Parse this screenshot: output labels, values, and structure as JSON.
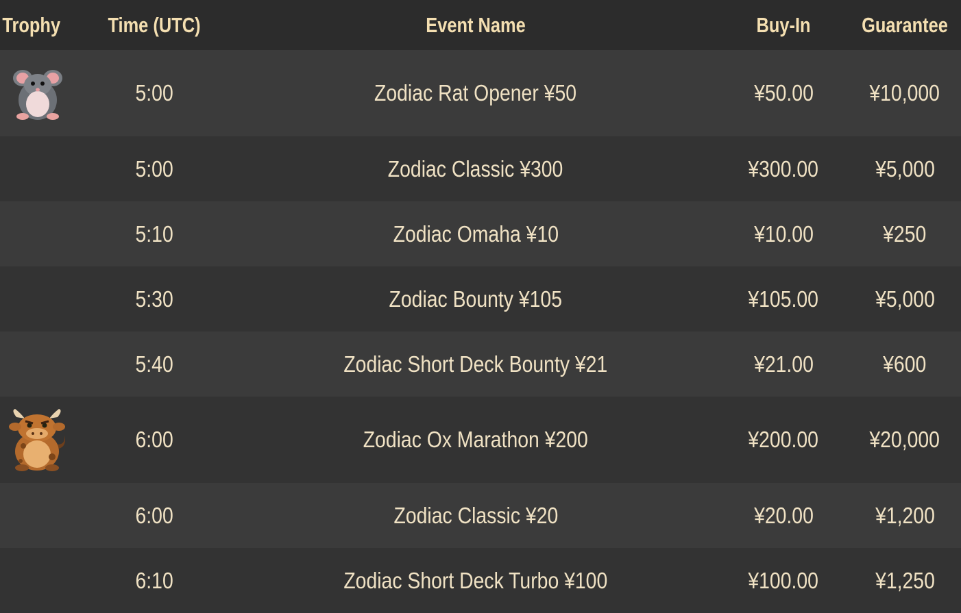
{
  "header": {
    "trophy": "Trophy",
    "time": "Time (UTC)",
    "event": "Event Name",
    "buyin": "Buy-In",
    "guarantee": "Guarantee"
  },
  "rows": [
    {
      "trophy_icon": "rat-trophy-icon",
      "time": "5:00",
      "event": "Zodiac Rat Opener ¥50",
      "buyin": "¥50.00",
      "guarantee": "¥10,000"
    },
    {
      "trophy_icon": "",
      "time": "5:00",
      "event": "Zodiac Classic ¥300",
      "buyin": "¥300.00",
      "guarantee": "¥5,000"
    },
    {
      "trophy_icon": "",
      "time": "5:10",
      "event": "Zodiac Omaha ¥10",
      "buyin": "¥10.00",
      "guarantee": "¥250"
    },
    {
      "trophy_icon": "",
      "time": "5:30",
      "event": "Zodiac Bounty ¥105",
      "buyin": "¥105.00",
      "guarantee": "¥5,000"
    },
    {
      "trophy_icon": "",
      "time": "5:40",
      "event": "Zodiac Short Deck Bounty ¥21",
      "buyin": "¥21.00",
      "guarantee": "¥600"
    },
    {
      "trophy_icon": "ox-trophy-icon",
      "time": "6:00",
      "event": "Zodiac Ox Marathon ¥200",
      "buyin": "¥200.00",
      "guarantee": "¥20,000"
    },
    {
      "trophy_icon": "",
      "time": "6:00",
      "event": "Zodiac Classic ¥20",
      "buyin": "¥20.00",
      "guarantee": "¥1,200"
    },
    {
      "trophy_icon": "",
      "time": "6:10",
      "event": "Zodiac Short Deck Turbo ¥100",
      "buyin": "¥100.00",
      "guarantee": "¥1,250"
    }
  ],
  "colors": {
    "header_text": "#f4dfb1",
    "body_text": "#f0e2c4",
    "row_odd": "#3b3b3b",
    "row_even": "#333333",
    "header_bg": "#2c2c2c"
  }
}
